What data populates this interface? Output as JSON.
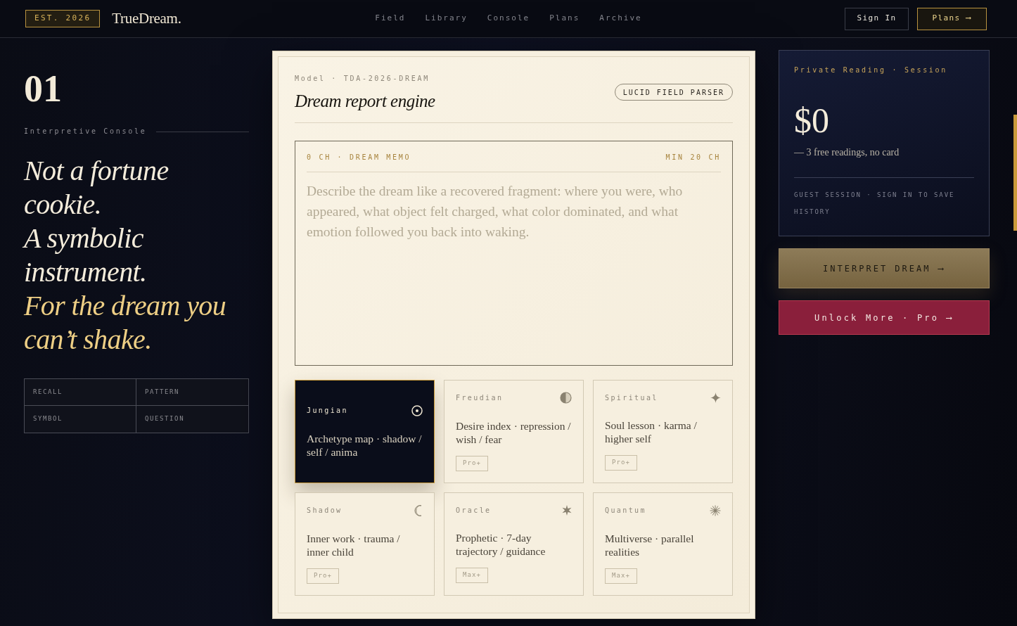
{
  "header": {
    "badge": "EST. 2026",
    "logo": "TrueDream.",
    "nav": [
      "Field",
      "Library",
      "Console",
      "Plans",
      "Archive"
    ],
    "actions": [
      {
        "label": "Sign In",
        "kind": "outline"
      },
      {
        "label": "Plans ⟶",
        "kind": "accent"
      }
    ]
  },
  "intro": {
    "index": "01",
    "eyebrow": "Interpretive Console",
    "headline": [
      {
        "text": "Not a fortune cookie.",
        "highlighted": false
      },
      {
        "text": "A symbolic instrument.",
        "highlighted": false
      },
      {
        "text": "For the dream you can’t shake.",
        "highlighted": true
      }
    ],
    "modes": [
      "RECALL",
      "PATTERN",
      "SYMBOL",
      "QUESTION"
    ]
  },
  "engine": {
    "model": "Model · TDA-2026-DREAM",
    "title": "Dream report engine",
    "badge": "LUCID FIELD PARSER",
    "memo": {
      "count": "0 CH · DREAM MEMO",
      "minimum": "MIN 20 CH",
      "placeholder": "Describe the dream like a recovered fragment: where you were, who appeared, what object felt charged, what color dominated, and what emotion followed you back into waking."
    },
    "lenses": [
      {
        "name": "Jungian",
        "description": "Archetype map · shadow / self / anima",
        "selected": true
      },
      {
        "name": "Freudian",
        "description": "Desire index · repression / wish / fear",
        "tier": "Pro+",
        "selected": false
      },
      {
        "name": "Spiritual",
        "description": "Soul lesson · karma / higher self",
        "tier": "Pro+",
        "selected": false
      },
      {
        "name": "Shadow",
        "description": "Inner work · trauma / inner child",
        "tier": "Pro+",
        "selected": false
      },
      {
        "name": "Oracle",
        "description": "Prophetic · 7-day trajectory / guidance",
        "tier": "Max+",
        "selected": false
      },
      {
        "name": "Quantum",
        "description": "Multiverse · parallel realities",
        "tier": "Max+",
        "selected": false
      }
    ]
  },
  "session": {
    "eyebrow": "Private Reading · Session",
    "price": "$0",
    "note": "— 3 free readings, no card",
    "status": "GUEST SESSION · SIGN IN TO SAVE HISTORY"
  },
  "actions": [
    {
      "label": "INTERPRET DREAM ⟶",
      "kind": "primary"
    },
    {
      "label": "Unlock More · Pro ⟶",
      "kind": "upgrade"
    }
  ]
}
